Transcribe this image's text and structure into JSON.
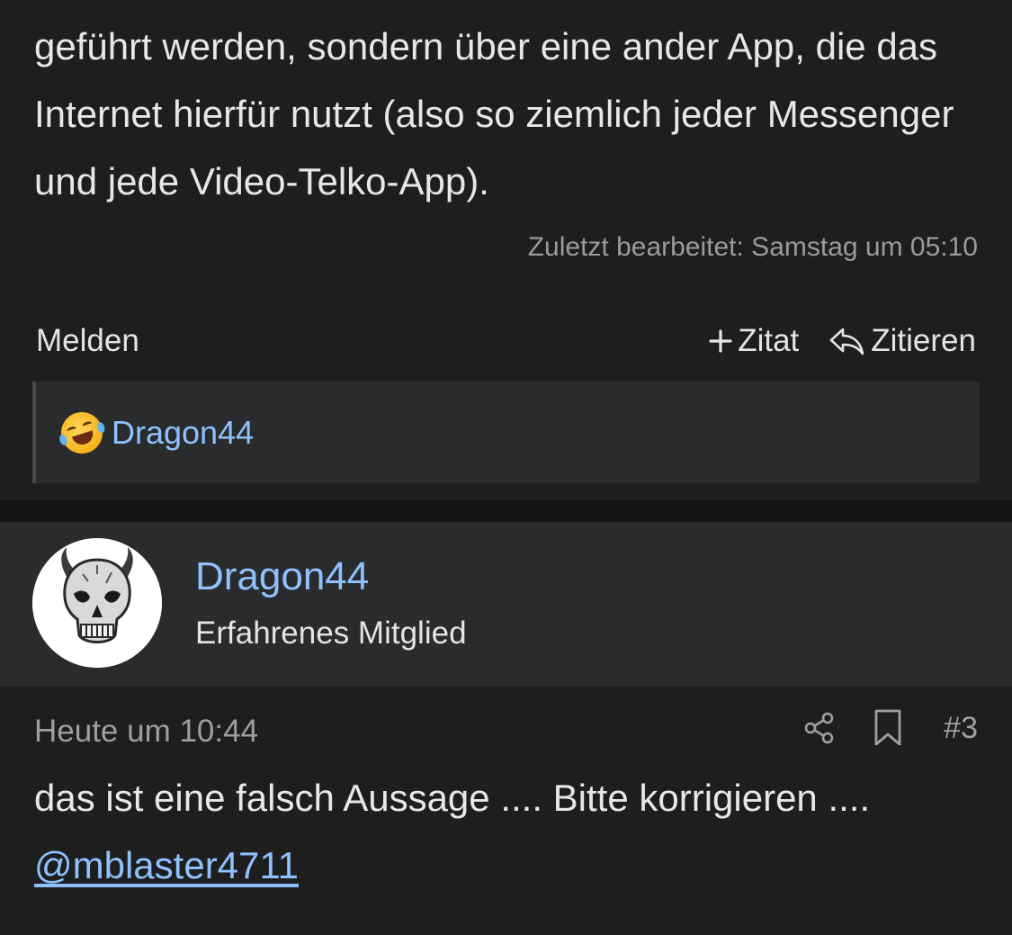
{
  "post1": {
    "body": "geführt werden, sondern über eine ander App, die das Internet hierfür nutzt (also so ziemlich jeder Messenger und jede Video-Telko-App).",
    "edited": "Zuletzt bearbeitet: Samstag um 05:10",
    "actions": {
      "report": "Melden",
      "add_quote": "Zitat",
      "reply": "Zitieren"
    },
    "reactions": {
      "emoji": "rolling-on-floor-laughing",
      "user": "Dragon44"
    }
  },
  "post2": {
    "author": {
      "name": "Dragon44",
      "title": "Erfahrenes Mitglied"
    },
    "date": "Heute um 10:44",
    "number": "#3",
    "body_text": "das ist eine falsch Aussage .... Bitte korrigieren .... ",
    "mention": "@mblaster4711"
  },
  "icons": {
    "plus": "plus-icon",
    "reply": "reply-icon",
    "share": "share-icon",
    "bookmark": "bookmark-icon"
  },
  "colors": {
    "background": "#1e1e1f",
    "panel": "#2a2b2d",
    "link": "#8fc1ff",
    "text": "#e4e4e4",
    "muted": "#9e9e9e"
  }
}
